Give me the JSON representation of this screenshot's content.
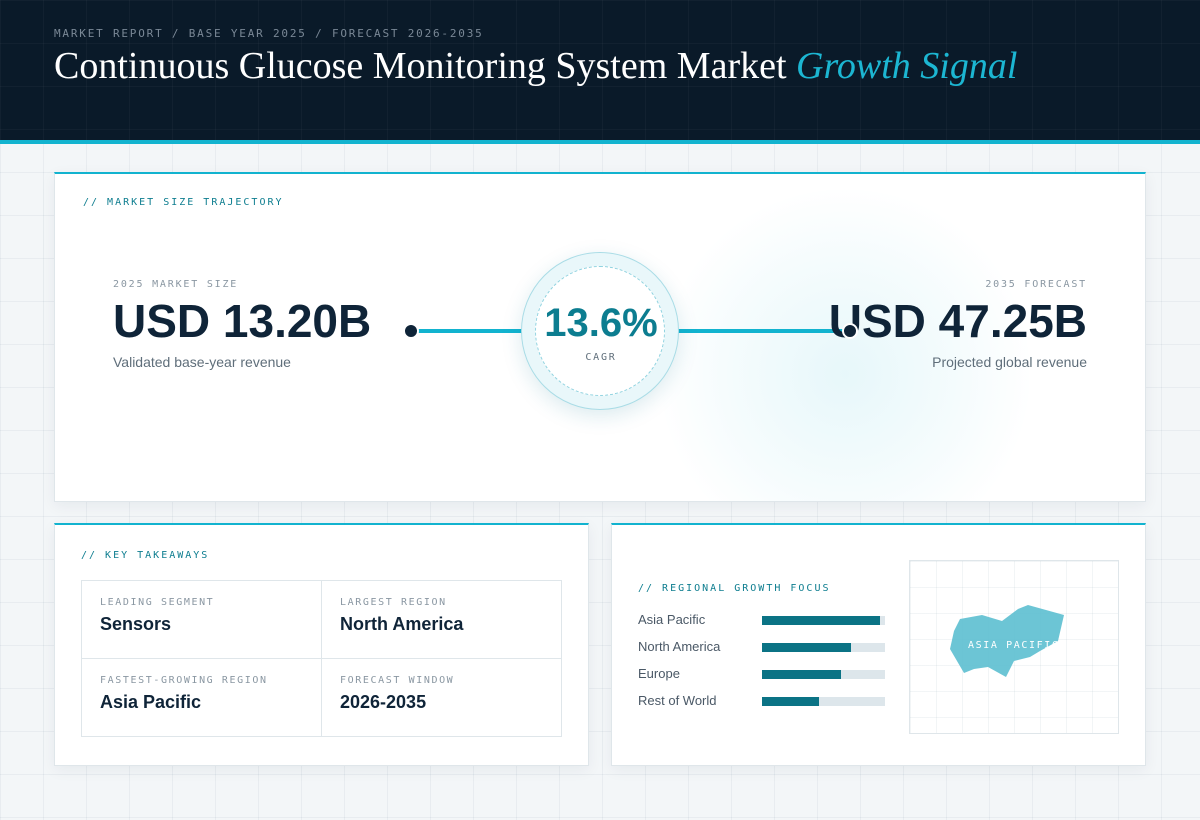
{
  "header": {
    "eyebrow": "MARKET REPORT / BASE YEAR 2025 / FORECAST 2026-2035",
    "title_main": "Continuous Glucose Monitoring System Market",
    "title_accent": "Growth Signal"
  },
  "trajectory": {
    "section_label": "// MARKET SIZE TRAJECTORY",
    "start": {
      "label": "2025 MARKET SIZE",
      "value": "USD 13.20B",
      "caption": "Validated base-year revenue"
    },
    "cagr": {
      "value": "13.6%",
      "label": "CAGR"
    },
    "end": {
      "label": "2035 FORECAST",
      "value": "USD 47.25B",
      "caption": "Projected global revenue"
    }
  },
  "takeaways": {
    "section_label": "// KEY TAKEAWAYS",
    "items": [
      {
        "label": "LEADING SEGMENT",
        "value": "Sensors"
      },
      {
        "label": "LARGEST REGION",
        "value": "North America"
      },
      {
        "label": "FASTEST-GROWING REGION",
        "value": "Asia Pacific"
      },
      {
        "label": "FORECAST WINDOW",
        "value": "2026-2035"
      }
    ]
  },
  "regional": {
    "section_label": "// REGIONAL GROWTH FOCUS",
    "bars": [
      {
        "name": "Asia Pacific",
        "fraction": 0.96
      },
      {
        "name": "North America",
        "fraction": 0.72
      },
      {
        "name": "Europe",
        "fraction": 0.64
      },
      {
        "name": "Rest of World",
        "fraction": 0.46
      }
    ],
    "map_label": "ASIA PACIFIC"
  },
  "colors": {
    "accent": "#12b3cf",
    "header_bg": "#0a1a29",
    "bar_fill": "#0b7385",
    "map_region": "#5cbfd0"
  }
}
